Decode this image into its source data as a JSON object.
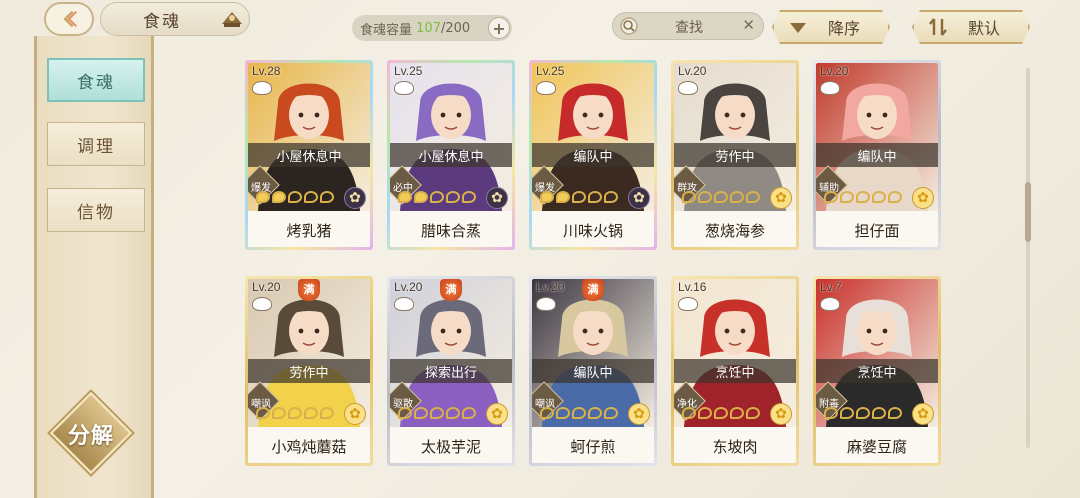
{
  "header": {
    "title": "食魂",
    "capacity_label": "食魂容量",
    "capacity_current": "107",
    "capacity_total": "/200",
    "search_label": "查找",
    "sort_order_label": "降序",
    "sort_key_label": "默认"
  },
  "sidebar": {
    "items": [
      {
        "label": "食魂"
      },
      {
        "label": "调理"
      },
      {
        "label": "信物"
      }
    ],
    "decompose_label": "分解"
  },
  "cards": [
    {
      "level": "Lv.28",
      "status": "小屋休息中",
      "role": "爆发",
      "stars": 2,
      "name": "烤乳猪",
      "elem": "dark",
      "frame": "rainbow",
      "full": "",
      "palette": [
        "#c94a1e",
        "#e8b64a",
        "#2b2420"
      ]
    },
    {
      "level": "Lv.25",
      "status": "小屋休息中",
      "role": "必中",
      "stars": 2,
      "name": "腊味合蒸",
      "elem": "dark",
      "frame": "rainbow",
      "full": "",
      "palette": [
        "#8a6bc4",
        "#e6e2ee",
        "#5b3b7e"
      ]
    },
    {
      "level": "Lv.25",
      "status": "编队中",
      "role": "爆发",
      "stars": 2,
      "name": "川味火锅",
      "elem": "dark",
      "frame": "rainbow",
      "full": "",
      "palette": [
        "#c62a2a",
        "#f0c458",
        "#3a2a20"
      ]
    },
    {
      "level": "Lv.20",
      "status": "劳作中",
      "role": "群攻",
      "stars": 0,
      "name": "葱烧海参",
      "elem": "light",
      "frame": "gold",
      "full": "",
      "palette": [
        "#4a4440",
        "#e4dccf",
        "#8f8a84"
      ]
    },
    {
      "level": "Lv.20",
      "status": "编队中",
      "role": "辅助",
      "stars": 0,
      "name": "担仔面",
      "elem": "light",
      "frame": "silver",
      "full": "",
      "palette": [
        "#f2a7a0",
        "#c0392b",
        "#e8d8c8"
      ]
    },
    {
      "level": "Lv.20",
      "status": "劳作中",
      "role": "嘲讽",
      "stars": 0,
      "name": "小鸡炖蘑菇",
      "elem": "light",
      "frame": "gold",
      "full": "满",
      "palette": [
        "#5a4a3a",
        "#d8c8b0",
        "#f2d24a"
      ]
    },
    {
      "level": "Lv.20",
      "status": "探索出行",
      "role": "驱散",
      "stars": 0,
      "name": "太极芋泥",
      "elem": "light",
      "frame": "silver",
      "full": "满",
      "palette": [
        "#6a6a7a",
        "#d0d0da",
        "#8b5fc0"
      ]
    },
    {
      "level": "Lv.20",
      "status": "编队中",
      "role": "嘲讽",
      "stars": 0,
      "name": "蚵仔煎",
      "elem": "light",
      "frame": "silver",
      "full": "满",
      "palette": [
        "#d8c8a0",
        "#3a3440",
        "#4a6aa8"
      ]
    },
    {
      "level": "Lv.16",
      "status": "烹饪中",
      "role": "净化",
      "stars": 0,
      "name": "东坡肉",
      "elem": "light",
      "frame": "gold",
      "full": "",
      "palette": [
        "#c8302a",
        "#f3e6d0",
        "#a0222a"
      ]
    },
    {
      "level": "Lv.7",
      "status": "烹饪中",
      "role": "附毒",
      "stars": 0,
      "name": "麻婆豆腐",
      "elem": "light",
      "frame": "gold",
      "full": "",
      "palette": [
        "#e8e0d8",
        "#c8302a",
        "#2a2a2a"
      ]
    }
  ]
}
